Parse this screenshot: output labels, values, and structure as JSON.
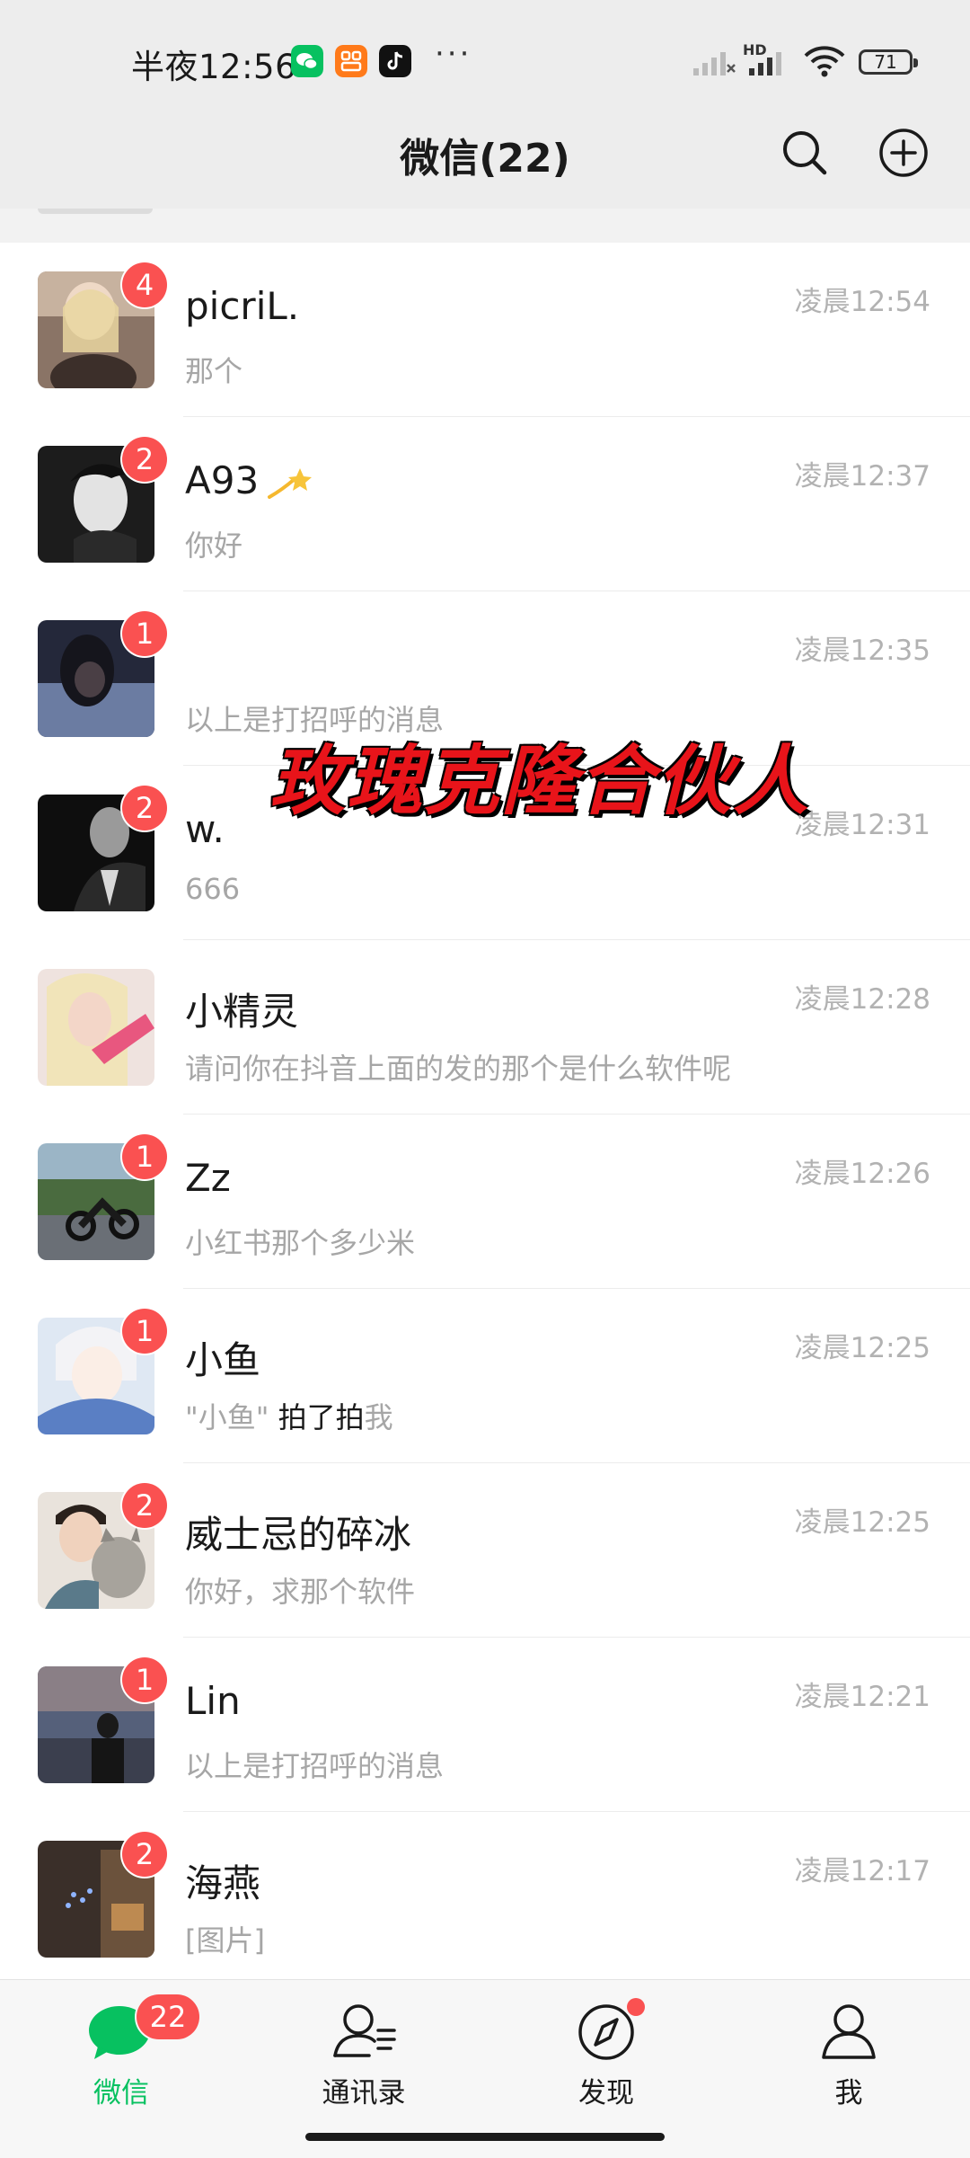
{
  "status_bar": {
    "time": "半夜12:56",
    "battery": "71",
    "network_label": "HD",
    "notification_icons": [
      "wechat-icon",
      "app-icon",
      "tiktok-icon"
    ],
    "more": "···"
  },
  "header": {
    "title": "微信(22)",
    "actions": [
      "search-icon",
      "add-circle-icon"
    ]
  },
  "chats": [
    {
      "name": "picriL.",
      "preview": "那个",
      "time": "凌晨12:54",
      "unread": "4",
      "avatar_color": "#b89a86"
    },
    {
      "name": "A93",
      "name_emoji": "dizzy-icon",
      "preview": "你好",
      "time": "凌晨12:37",
      "unread": "2",
      "avatar_color": "#3a3a3a"
    },
    {
      "name": "",
      "preview": "以上是打招呼的消息",
      "time": "凌晨12:35",
      "unread": "1",
      "avatar_color": "#2b2d3a"
    },
    {
      "name": "w.",
      "preview": "666",
      "time": "凌晨12:31",
      "unread": "2",
      "avatar_color": "#1e1e1e"
    },
    {
      "name": "小精灵",
      "preview": "请问你在抖音上面的发的那个是什么软件呢",
      "time": "凌晨12:28",
      "unread": "",
      "avatar_color": "#e8b7a6"
    },
    {
      "name": "Zz",
      "preview": "小红书那个多少米",
      "time": "凌晨12:26",
      "unread": "1",
      "avatar_color": "#5b6b7a"
    },
    {
      "name": "小鱼",
      "preview_parts": [
        "\"小鱼\" ",
        "拍了拍",
        "我"
      ],
      "time": "凌晨12:25",
      "unread": "1",
      "avatar_color": "#c9d6ea"
    },
    {
      "name": "威士忌的碎冰",
      "preview": "你好，求那个软件",
      "time": "凌晨12:25",
      "unread": "2",
      "avatar_color": "#cfc6bd"
    },
    {
      "name": "Lin",
      "preview": "以上是打招呼的消息",
      "time": "凌晨12:21",
      "unread": "1",
      "avatar_color": "#3d4150"
    },
    {
      "name": "海燕",
      "preview": "[图片]",
      "time": "凌晨12:17",
      "unread": "2",
      "avatar_color": "#5a4a3e"
    }
  ],
  "overlay_caption": "玫瑰克隆合伙人",
  "tabbar": {
    "tabs": [
      {
        "label": "微信",
        "icon": "chat-bubble-icon",
        "badge": "22",
        "active": true
      },
      {
        "label": "通讯录",
        "icon": "contacts-icon"
      },
      {
        "label": "发现",
        "icon": "compass-icon",
        "dot": true
      },
      {
        "label": "我",
        "icon": "person-icon"
      }
    ]
  },
  "colors": {
    "brand_green": "#07c160",
    "badge_red": "#fa5151",
    "header_bg": "#ededed"
  }
}
